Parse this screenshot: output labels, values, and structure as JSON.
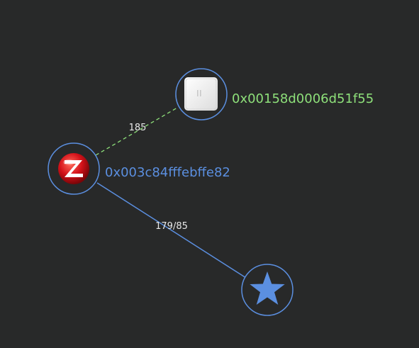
{
  "graph": {
    "nodes": {
      "coordinator": {
        "ieee_address": "0x003c84fffebffe82",
        "label_color": "#5b8fe0",
        "icon": "zigbee-logo-icon"
      },
      "end_device": {
        "ieee_address": "0x00158d0006d51f55",
        "label_color": "#8ee07a",
        "icon": "vibration-sensor-device-icon"
      },
      "group": {
        "icon": "star-icon",
        "icon_color": "#5b8fe0"
      }
    },
    "links": {
      "coordinator_to_end_device": {
        "lqi": "185",
        "style": "dashed",
        "color": "#8ee07a"
      },
      "coordinator_to_group": {
        "lqi": "179/85",
        "style": "solid",
        "color": "#5b8fe0"
      }
    }
  },
  "colors": {
    "background": "#282929",
    "ring": "#5b8fe0"
  }
}
